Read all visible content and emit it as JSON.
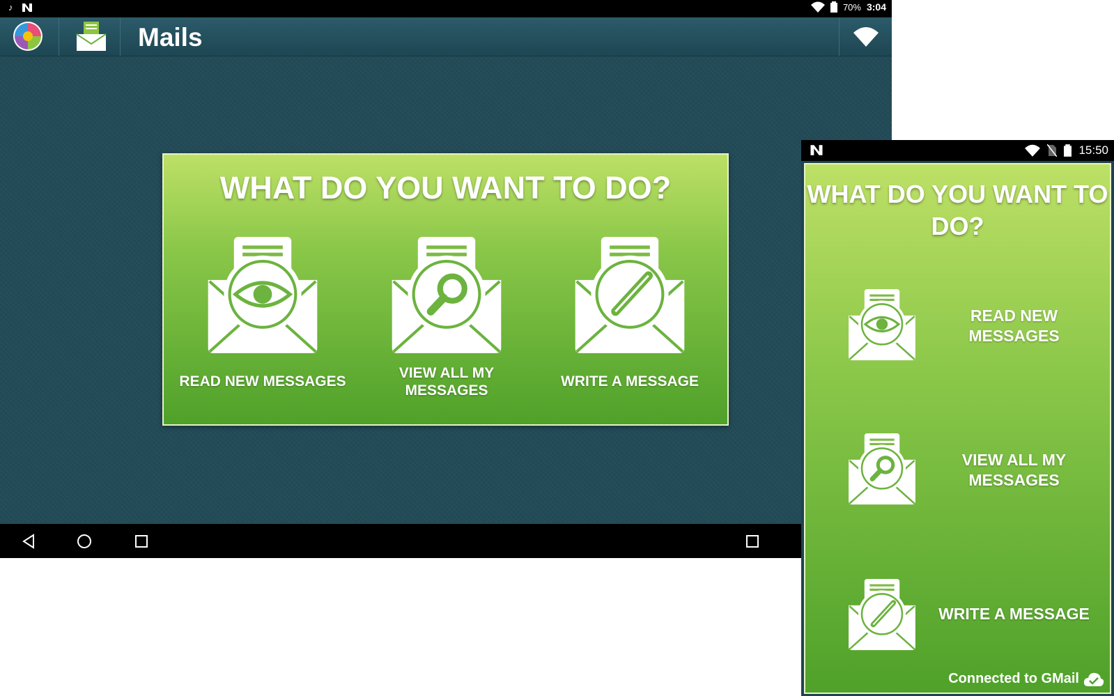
{
  "tablet": {
    "status_bar": {
      "battery": "70%",
      "time": "3:04"
    },
    "action_bar": {
      "title": "Mails"
    },
    "panel": {
      "title": "WHAT DO YOU WANT TO DO?",
      "options": [
        {
          "label_line1": "READ NEW MESSAGES",
          "label_line2": "",
          "icon": "eye-envelope-icon"
        },
        {
          "label_line1": "VIEW ALL MY",
          "label_line2": "MESSAGES",
          "icon": "magnifier-envelope-icon"
        },
        {
          "label_line1": "WRITE A MESSAGE",
          "label_line2": "",
          "icon": "pencil-envelope-icon"
        }
      ]
    },
    "nav_bar": {
      "icons": [
        "back-icon",
        "home-icon",
        "recents-icon",
        "recents-icon"
      ]
    }
  },
  "phone": {
    "status_bar": {
      "time": "15:50"
    },
    "panel": {
      "title_line1": "WHAT DO YOU WANT TO",
      "title_line2": "DO?",
      "options": [
        {
          "label_line1": "READ NEW",
          "label_line2": "MESSAGES",
          "icon": "eye-envelope-icon"
        },
        {
          "label_line1": "VIEW ALL MY",
          "label_line2": "MESSAGES",
          "icon": "magnifier-envelope-icon"
        },
        {
          "label_line1": "WRITE A MESSAGE",
          "label_line2": "",
          "icon": "pencil-envelope-icon"
        }
      ],
      "footer": "Connected to GMail"
    }
  },
  "colors": {
    "panel_top": "#bde066",
    "panel_bottom": "#4fa12a",
    "background": "#224b57",
    "icon_line": "#6cb33f"
  }
}
